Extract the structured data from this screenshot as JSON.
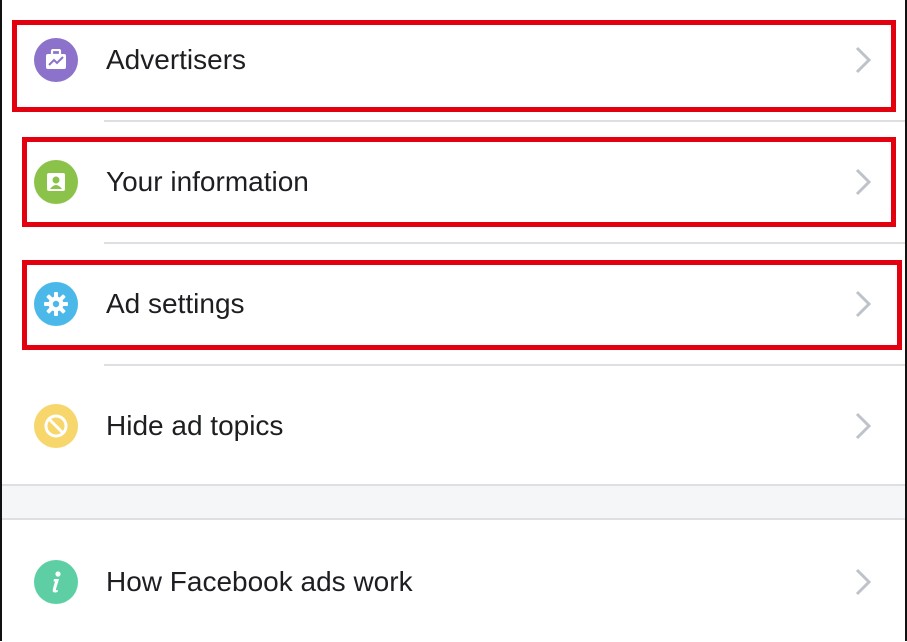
{
  "menu": {
    "items": [
      {
        "label": "Advertisers",
        "icon": "briefcase-icon",
        "icon_color": "#8c72cb"
      },
      {
        "label": "Your information",
        "icon": "profile-card-icon",
        "icon_color": "#8bc34a"
      },
      {
        "label": "Ad settings",
        "icon": "gear-icon",
        "icon_color": "#4ab8e8"
      },
      {
        "label": "Hide ad topics",
        "icon": "block-icon",
        "icon_color": "#f7d66c"
      }
    ],
    "bottom_items": [
      {
        "label": "How Facebook ads work",
        "icon": "info-icon",
        "icon_color": "#5ecfa5"
      }
    ]
  },
  "annotation_color": "#e3000f"
}
